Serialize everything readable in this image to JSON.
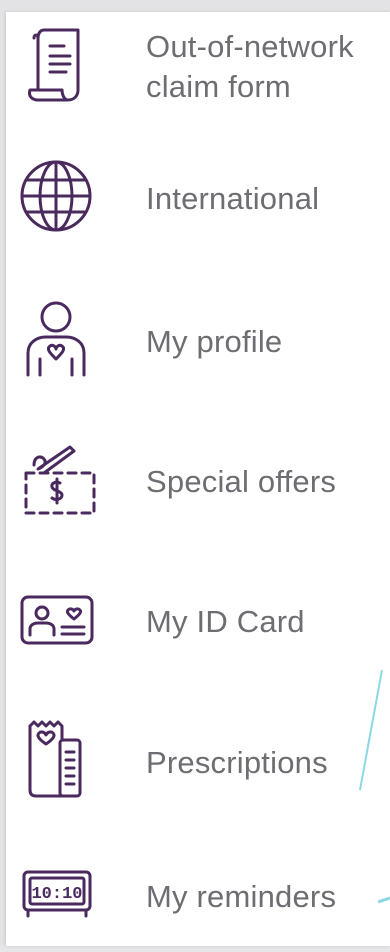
{
  "menu": {
    "items": [
      {
        "label": "Out-of-network\nclaim form",
        "icon": "claim-form-icon"
      },
      {
        "label": "International",
        "icon": "globe-icon"
      },
      {
        "label": "My profile",
        "icon": "profile-icon"
      },
      {
        "label": "Special offers",
        "icon": "special-offers-icon"
      },
      {
        "label": "My ID Card",
        "icon": "id-card-icon"
      },
      {
        "label": "Prescriptions",
        "icon": "prescriptions-icon"
      },
      {
        "label": "My reminders",
        "icon": "reminders-clock-icon"
      }
    ]
  },
  "icons": {
    "clock_text": "10:10"
  },
  "colors": {
    "icon": "#4a2a5e",
    "label": "#6d6d72",
    "background": "#ffffff",
    "accent_line": "#7fd3e0"
  }
}
